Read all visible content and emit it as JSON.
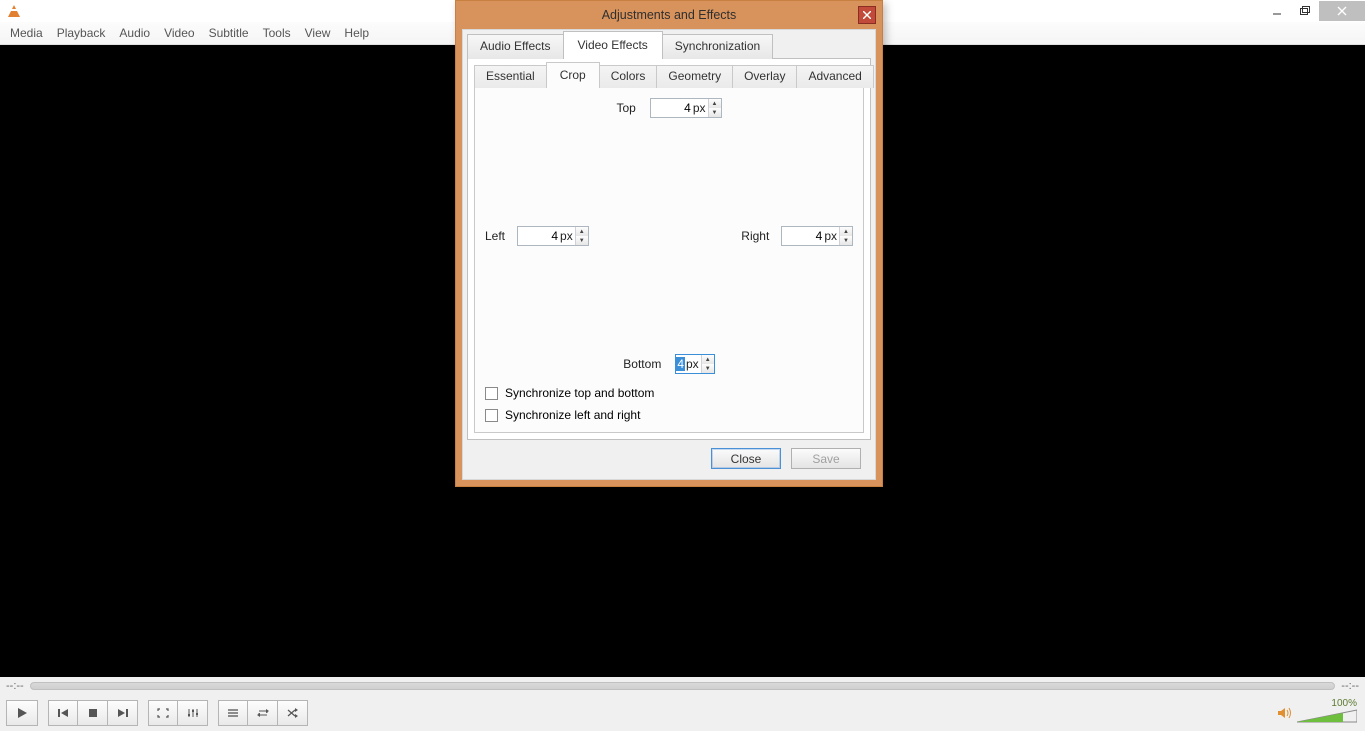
{
  "menubar": [
    "Media",
    "Playback",
    "Audio",
    "Video",
    "Subtitle",
    "Tools",
    "View",
    "Help"
  ],
  "time": {
    "left": "--:--",
    "right": "--:--"
  },
  "volume": {
    "pct": "100%"
  },
  "dialog": {
    "title": "Adjustments and Effects",
    "tabs": [
      "Audio Effects",
      "Video Effects",
      "Synchronization"
    ],
    "subtabs": [
      "Essential",
      "Crop",
      "Colors",
      "Geometry",
      "Overlay",
      "Advanced"
    ],
    "crop": {
      "top_label": "Top",
      "top_value": "4",
      "left_label": "Left",
      "left_value": "4",
      "right_label": "Right",
      "right_value": "4",
      "bottom_label": "Bottom",
      "bottom_value": "4",
      "unit_suffix": "px",
      "sync_tb": "Synchronize top and bottom",
      "sync_lr": "Synchronize left and right"
    },
    "close_label": "Close",
    "save_label": "Save"
  }
}
